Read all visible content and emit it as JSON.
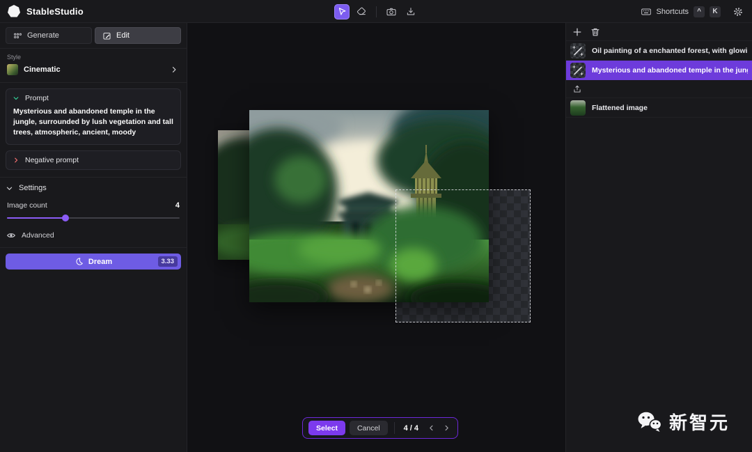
{
  "app": {
    "title": "StableStudio"
  },
  "topbar": {
    "shortcuts": {
      "label": "Shortcuts",
      "keys": [
        "^",
        "K"
      ]
    }
  },
  "tabs": {
    "generate": "Generate",
    "edit": "Edit"
  },
  "style_section": {
    "label": "Style",
    "value": "Cinematic"
  },
  "prompt": {
    "header": "Prompt",
    "text": "Mysterious and abandoned temple in the jungle, surrounded by lush vegetation and tall trees, atmospheric, ancient, moody"
  },
  "negative_prompt": {
    "header": "Negative prompt"
  },
  "settings": {
    "header": "Settings",
    "image_count_label": "Image count",
    "image_count_value": "4",
    "advanced_label": "Advanced"
  },
  "dream": {
    "label": "Dream",
    "badge": "3.33"
  },
  "layers": {
    "items": [
      {
        "label": "Oil painting of a enchanted forest, with glowing …",
        "selected": false
      },
      {
        "label": "Mysterious and abandoned temple in the jungle, …",
        "selected": true
      },
      {
        "label": "Flattened image",
        "selected": false
      }
    ]
  },
  "canvas_bar": {
    "select": "Select",
    "cancel": "Cancel",
    "pagination": "4 / 4"
  },
  "watermark": {
    "text": "新智元"
  },
  "colors": {
    "accent_tool": "#7c5cf0",
    "selected_row": "#6d3bdb",
    "dream_button": "#6e5ce4",
    "select_button": "#7c3aed",
    "slider": "#8b5cf6",
    "prompt_chevron": "#34d399",
    "negative_chevron": "#f87171",
    "bar_border": "#6d28d9"
  }
}
